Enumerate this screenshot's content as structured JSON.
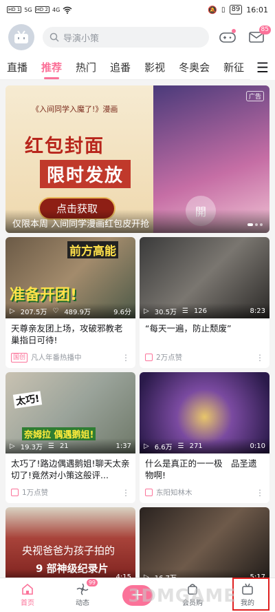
{
  "status": {
    "sim1": "HD 1",
    "sim2": "HD 2",
    "net1": "5G",
    "net2": "4G",
    "battery": "89",
    "time": "16:01"
  },
  "header": {
    "search_placeholder": "导演小策",
    "message_count": "85"
  },
  "tabs": [
    "直播",
    "推荐",
    "热门",
    "追番",
    "影视",
    "冬奥会",
    "新征"
  ],
  "active_tab": "推荐",
  "banner": {
    "ribbon": "《入间同学入魔了!》漫画",
    "line1": "红包封面",
    "line2": "限时发放",
    "button": "点击获取",
    "open": "開",
    "ad_badge": "广告",
    "caption": "仅限本周 入间同学漫画红包皮开抢"
  },
  "cards": [
    {
      "overlay_top": "前方高能",
      "overlay_bottom": "准备开团!",
      "views": "207.5万",
      "likes": "489.9万",
      "duration": "9.6分",
      "title": "天尊亲友团上场，攻破邪教老巢指日可待!",
      "tag": "国创",
      "meta": "凡人年番热播中"
    },
    {
      "views": "30.5万",
      "danmaku": "126",
      "duration": "8:23",
      "title": "“每天一遍，防止颓废”",
      "meta": "2万点赞"
    },
    {
      "overlay_top": "太巧!",
      "overlay_bottom": "奈姆拉 偶遇鹅姐!",
      "views": "19.3万",
      "danmaku": "21",
      "duration": "1:37",
      "title": "太巧了!路边偶遇鹅姐!聊天太亲切了!竟然对小策这般评...",
      "meta": "1万点赞"
    },
    {
      "views": "6.6万",
      "danmaku": "271",
      "duration": "0:10",
      "title": "什么是真正的一一极　品圣遗物啊!",
      "meta": "东阳知林木"
    },
    {
      "overlay_top": "央视爸爸为孩子拍的",
      "overlay_bottom": "9 部神级纪录片",
      "duration": "4:15"
    },
    {
      "views": "16.7万",
      "duration": "5:17"
    }
  ],
  "bottom_nav": [
    {
      "label": "首页",
      "icon": "home-icon"
    },
    {
      "label": "动态",
      "icon": "dynamic-icon",
      "badge": "99"
    },
    {
      "label": "",
      "icon": "plus-icon"
    },
    {
      "label": "会员购",
      "icon": "shop-icon"
    },
    {
      "label": "我的",
      "icon": "tv-icon"
    }
  ],
  "watermark": "3DMGAME",
  "colors": {
    "accent": "#fb7299",
    "highlight_box": "#e02020"
  }
}
